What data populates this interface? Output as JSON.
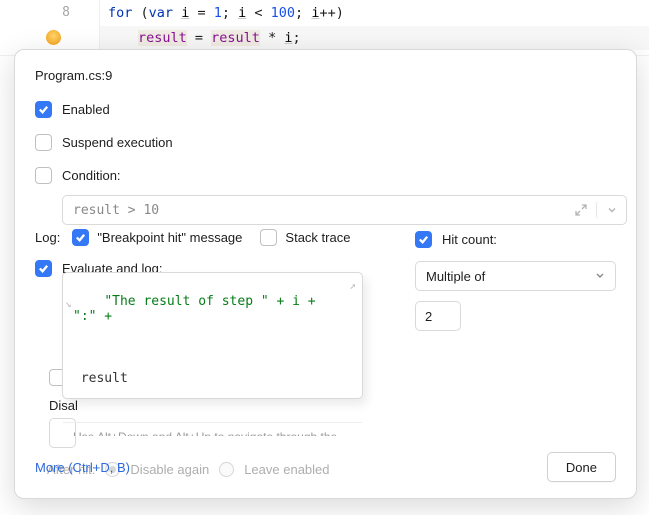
{
  "editor": {
    "line8_number": "8",
    "line8": {
      "kw_for": "for",
      "open": " (",
      "kw_var": "var",
      "sp": " ",
      "var_i": "i",
      "eq": " = ",
      "n1": "1",
      "semi1": "; ",
      "var_i2": "i",
      "lt": " < ",
      "n100": "100",
      "semi2": "; ",
      "var_i3": "i",
      "pp": "++",
      "close": ")"
    },
    "line9": {
      "res1": "result",
      "eq": " = ",
      "res2": "result",
      "mul": " * ",
      "var_i": "i",
      "semi": ";"
    }
  },
  "popover": {
    "title": "Program.cs:9",
    "enabled_label": "Enabled",
    "suspend_label": "Suspend execution",
    "condition_label": "Condition:",
    "condition_value": "result > 10",
    "log_label": "Log:",
    "bp_hit_msg_label": "\"Breakpoint hit\" message",
    "stack_trace_label": "Stack trace",
    "eval_log_label": "Evaluate and log:",
    "eval_expr_line1": "\"The result of step \" + i + \":\" +",
    "eval_expr_line2": " result",
    "eval_hint": "Use Alt+Down and Alt+Up to navigate through the",
    "disable_until_fragment": "Disal",
    "hit_count_label": "Hit count:",
    "hit_mode": "Multiple of",
    "hit_value": "2",
    "after_hit_label": "After hit:",
    "after_hit_disable": "Disable again",
    "after_hit_leave": "Leave enabled",
    "more_link": "More (Ctrl+D, B)",
    "done_label": "Done"
  }
}
